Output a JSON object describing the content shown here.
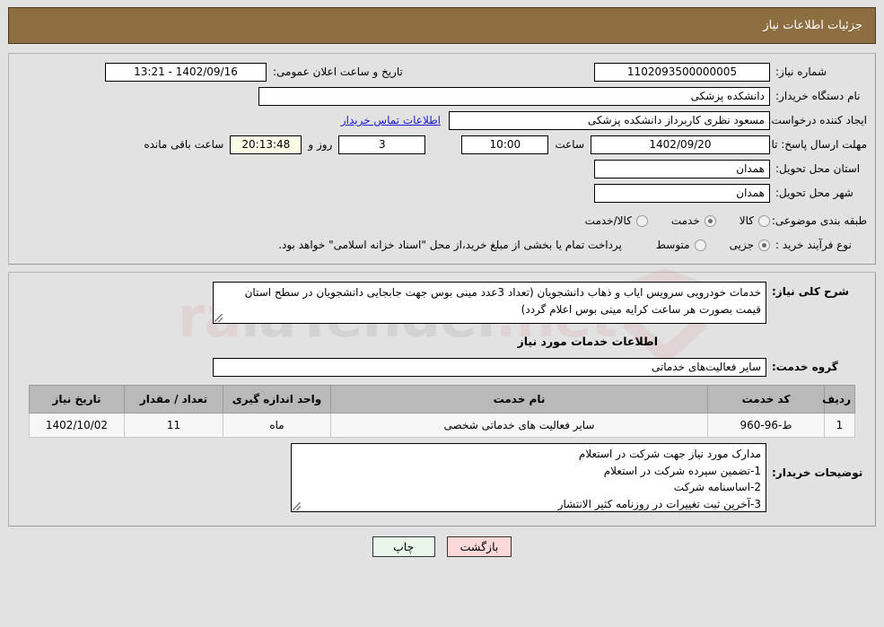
{
  "header": {
    "title": "جزئیات اطلاعات نیاز",
    "bg_color": "#8d6e41"
  },
  "watermark": {
    "text_left": "ra",
    "text_mid": "iaTender",
    "text_right": ".net",
    "full": "AriaTender.net"
  },
  "form": {
    "need_number_label": "شماره نیاز:",
    "need_number_value": "1102093500000005",
    "public_announce_label": "تاریخ و ساعت اعلان عمومی:",
    "public_announce_value": "1402/09/16 - 13:21",
    "buyer_org_label": "نام دستگاه خریدار:",
    "buyer_org_value": "دانشکده پزشکی",
    "creator_label": "ایجاد کننده درخواست:",
    "creator_value": "مسعود نظری کاربرداز دانشکده پزشکی",
    "contact_link": "اطلاعات تماس خریدار",
    "deadline_label": "مهلت ارسال پاسخ: تا تاریخ:",
    "deadline_date": "1402/09/20",
    "time_label": "ساعت",
    "deadline_time": "10:00",
    "days_remaining": "3",
    "days_label": "روز و",
    "countdown": "20:13:48",
    "countdown_label": "ساعت باقی مانده",
    "province_label": "استان محل تحویل:",
    "province_value": "همدان",
    "city_label": "شهر محل تحویل:",
    "city_value": "همدان",
    "category_label": "طبقه بندی موضوعی:",
    "category_options": [
      {
        "label": "کالا",
        "selected": false
      },
      {
        "label": "خدمت",
        "selected": true
      },
      {
        "label": "کالا/خدمت",
        "selected": false
      }
    ],
    "process_label": "نوع فرآیند خرید :",
    "process_options": [
      {
        "label": "جزیی",
        "selected": true
      },
      {
        "label": "متوسط",
        "selected": false
      }
    ],
    "process_note": "پرداخت تمام یا بخشی از مبلغ خرید،از محل \"اسناد خزانه اسلامی\" خواهد بود."
  },
  "description": {
    "label": "شرح کلی نیاز:",
    "value": "خدمات خودرویی سرویس ایاب و ذهاب دانشجویان (تعداد 3عدد مینی بوس جهت جابجایی دانشجویان در سطح استان  قیمت بصورت هر ساعت کرایه مینی بوس اعلام گردد)"
  },
  "services_section": {
    "title": "اطلاعات خدمات مورد نیاز",
    "group_label": "گروه خدمت:",
    "group_value": "سایر فعالیت‌های خدماتی"
  },
  "table": {
    "headers": [
      "ردیف",
      "کد خدمت",
      "نام خدمت",
      "واحد اندازه گیری",
      "تعداد / مقدار",
      "تاریخ نیاز"
    ],
    "rows": [
      {
        "radif": "1",
        "code": "ط-96-960",
        "name": "سایر فعالیت های خدماتی شخصی",
        "unit": "ماه",
        "quantity": "11",
        "need_date": "1402/10/02"
      }
    ]
  },
  "buyer_notes": {
    "label": "توضیحات خریدار:",
    "value": "مدارک مورد نیاز جهت شرکت در استعلام\n1-تضمین سپرده شرکت در استعلام\n2-اساسنامه شرکت\n3-آخرین ثبت تغییرات در روزنامه کثیر الانتشار"
  },
  "footer": {
    "print_label": "چاپ",
    "back_label": "بازگشت",
    "print_color": "#e9f7ea",
    "back_color": "#fbd9d9"
  }
}
